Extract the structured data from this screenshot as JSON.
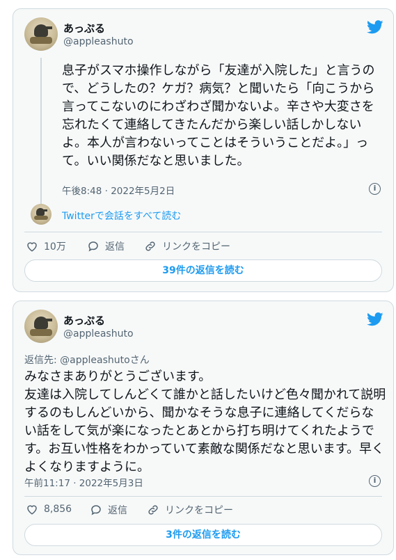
{
  "tweet1": {
    "author_name": "あっぷる",
    "handle": "@appleashuto",
    "text": "息子がスマホ操作しながら「友達が入院した」と言うので、どうしたの？ケガ？病気？と聞いたら「向こうから言ってこないのにわざわざ聞かないよ。辛さや大変さを忘れたくて連絡してきたんだから楽しい話しかしないよ。本人が言わないってことはそういうことだよ。」って。いい関係だなと思いました。",
    "timestamp": "午後8:48 · 2022年5月2日",
    "thread_link": "Twitterで会話をすべて読む",
    "likes": "10万",
    "reply_label": "返信",
    "copy_link_label": "リンクをコピー",
    "read_replies": "39件の返信を読む"
  },
  "tweet2": {
    "author_name": "あっぷる",
    "handle": "@appleashuto",
    "reply_to": "返信先: @appleashutoさん",
    "text": "みなさまありがとうございます。\n友達は入院してしんどくて誰かと話したいけど色々聞かれて説明するのもしんどいから、聞かなそうな息子に連絡してくだらない話をして気が楽になったとあとから打ち明けてくれたようです。お互い性格をわかっていて素敵な関係だなと思います。早くよくなりますように。",
    "timestamp": "午前11:17 · 2022年5月3日",
    "likes": "8,856",
    "reply_label": "返信",
    "copy_link_label": "リンクをコピー",
    "read_replies": "3件の返信を読む"
  },
  "icons": [
    "twitter-bird-icon",
    "heart-icon",
    "reply-icon",
    "link-icon",
    "info-icon",
    "avatar"
  ],
  "colors": {
    "accent": "#1d9bf0",
    "muted": "#536471",
    "card_bg": "#f7f9f9",
    "border": "#cfd9de"
  }
}
